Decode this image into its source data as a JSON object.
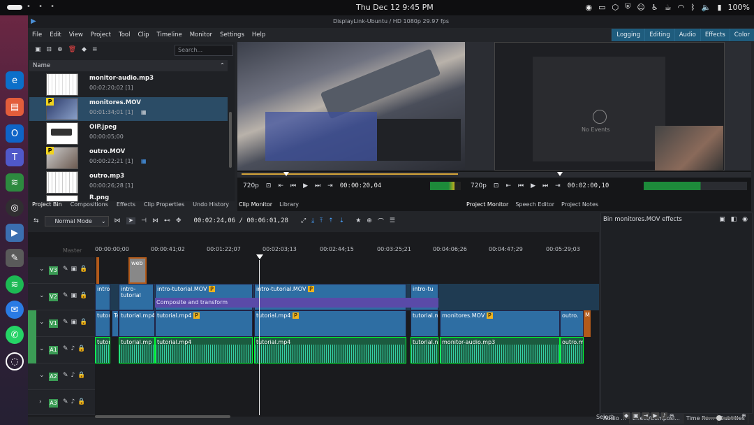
{
  "topbar": {
    "clock": "Thu Dec 12   9:45 PM",
    "battery": "100%"
  },
  "window": {
    "title": "DisplayLink-Ubuntu / HD 1080p 29.97 fps"
  },
  "menu": [
    "File",
    "Edit",
    "View",
    "Project",
    "Tool",
    "Clip",
    "Timeline",
    "Monitor",
    "Settings",
    "Help"
  ],
  "workspaces": [
    "Logging",
    "Editing",
    "Audio",
    "Effects",
    "Color"
  ],
  "bin": {
    "search_placeholder": "Search...",
    "column": "Name",
    "clips": [
      {
        "name": "monitor-audio.mp3",
        "duration": "00:02:20;02 [1]"
      },
      {
        "name": "monitores.MOV",
        "duration": "00:01:34;01 [1]"
      },
      {
        "name": "OIP.jpeg",
        "duration": "00:00:05;00"
      },
      {
        "name": "outro.MOV",
        "duration": "00:00:22;21 [1]"
      },
      {
        "name": "outro.mp3",
        "duration": "00:00:26;28 [1]"
      },
      {
        "name": "R.png",
        "duration": ""
      }
    ],
    "tabs": [
      "Project Bin",
      "Compositions",
      "Effects",
      "Clip Properties",
      "Undo History"
    ]
  },
  "clip_monitor": {
    "res": "720p",
    "timecode": "00:00:20,04",
    "tabs": [
      "Clip Monitor",
      "Library"
    ]
  },
  "project_monitor": {
    "res": "720p",
    "timecode": "00:02:00,10",
    "no_events": "No Events",
    "tabs": [
      "Project Monitor",
      "Speech Editor",
      "Project Notes"
    ]
  },
  "timeline_toolbar": {
    "mode": "Normal Mode",
    "position": "00:02:24,06 / 00:06:01,28"
  },
  "ruler": [
    "00:00:00;00",
    "00:00:41;02",
    "00:01:22;07",
    "00:02:03;13",
    "00:02:44;15",
    "00:03:25;21",
    "00:04:06;26",
    "00:04:47;29",
    "00:05:29;03"
  ],
  "tracks": {
    "V3": "V3",
    "V2": "V2",
    "V1": "V1",
    "A1": "A1",
    "A2": "A2",
    "A3": "A3",
    "master": "Master"
  },
  "clips_text": {
    "v3_web": "web",
    "v2_intro1": "intro-",
    "v2_intro2": "intro-tutorial",
    "v2_intro3": "intro-tutorial.MOV",
    "v2_intro4": "intro-tutorial.MOV",
    "v2_intro5": "intro-tu",
    "composite": "Composite and transform",
    "v1_tut1": "tutor",
    "v1_te": "Te",
    "v1_tut2": "tutorial.mp4",
    "v1_tut3": "tutorial.mp4",
    "v1_tut4": "tutorial.mp4",
    "v1_tut5": "tutorial.m",
    "v1_mon": "monitores.MOV",
    "v1_out": "outro.",
    "v1_m": "M",
    "a1_tut1": "tutori",
    "a1_tut2": "tutorial.mp",
    "a1_tut3": "tutorial.mp4",
    "a1_tut4": "tutorial.mp4",
    "a1_tut5": "tutorial.n",
    "a1_mon": "monitor-audio.mp3",
    "a1_out": "outro.mp"
  },
  "effects_panel": {
    "title": "Bin monitores.MOV effects",
    "tabs": [
      "Audio ...",
      "Effect/Composi...",
      "Time Re...",
      "Subtitles"
    ]
  },
  "status": {
    "select": "Select"
  }
}
